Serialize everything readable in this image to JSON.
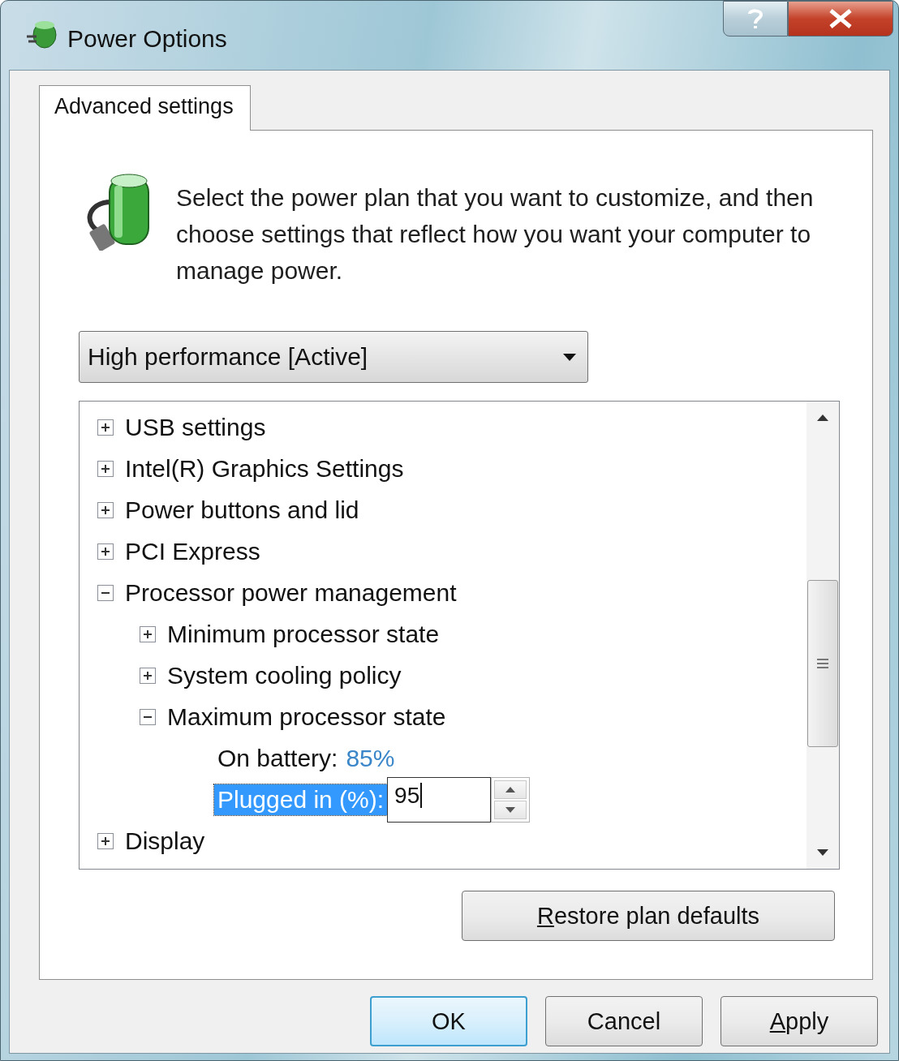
{
  "window": {
    "title": "Power Options"
  },
  "tabs": [
    {
      "label": "Advanced settings",
      "selected": true
    }
  ],
  "description": "Select the power plan that you want to customize, and then choose settings that reflect how you want your computer to manage power.",
  "plan_dropdown": {
    "value": "High performance [Active]"
  },
  "tree": [
    {
      "label": "USB settings",
      "expanded": false
    },
    {
      "label": "Intel(R) Graphics Settings",
      "expanded": false
    },
    {
      "label": "Power buttons and lid",
      "expanded": false
    },
    {
      "label": "PCI Express",
      "expanded": false
    },
    {
      "label": "Processor power management",
      "expanded": true,
      "children": [
        {
          "label": "Minimum processor state",
          "expanded": false
        },
        {
          "label": "System cooling policy",
          "expanded": false
        },
        {
          "label": "Maximum processor state",
          "expanded": true,
          "settings": [
            {
              "kind": "value",
              "label": "On battery:",
              "value": "85%",
              "selected": false
            },
            {
              "kind": "editor",
              "label": "Plugged in (%):",
              "value": "95",
              "selected": true
            }
          ]
        }
      ]
    },
    {
      "label": "Display",
      "expanded": false
    }
  ],
  "restore_button": {
    "label": "Restore plan defaults",
    "underline_first": true
  },
  "buttons": [
    {
      "label": "OK",
      "default": true,
      "underline_first": false
    },
    {
      "label": "Cancel",
      "default": false,
      "underline_first": false
    },
    {
      "label": "Apply",
      "default": false,
      "underline_first": true
    }
  ]
}
